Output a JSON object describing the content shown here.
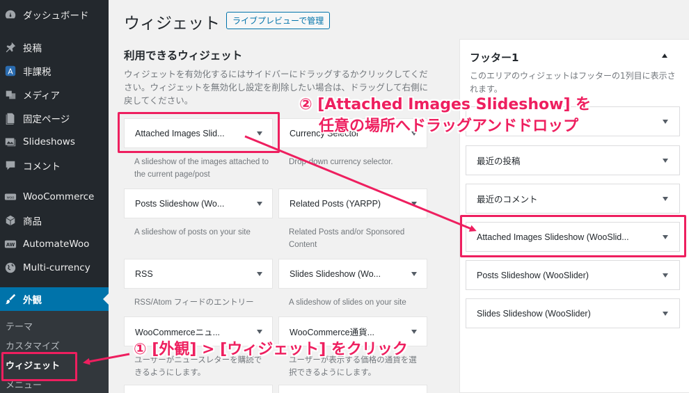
{
  "sidebar": {
    "items": [
      {
        "label": "ダッシュボード",
        "icon": "dashboard-icon"
      },
      {
        "label": "投稿",
        "icon": "pin-icon"
      },
      {
        "label": "非課税",
        "icon": "tax-icon"
      },
      {
        "label": "メディア",
        "icon": "media-icon"
      },
      {
        "label": "固定ページ",
        "icon": "page-icon"
      },
      {
        "label": "Slideshows",
        "icon": "slideshow-icon"
      },
      {
        "label": "コメント",
        "icon": "comment-icon"
      },
      {
        "label": "WooCommerce",
        "icon": "woo-icon"
      },
      {
        "label": "商品",
        "icon": "product-icon"
      },
      {
        "label": "AutomateWoo",
        "icon": "aw-icon"
      },
      {
        "label": "Multi-currency",
        "icon": "globe-icon"
      },
      {
        "label": "外観",
        "icon": "brush-icon"
      }
    ],
    "submenu": [
      "テーマ",
      "カスタマイズ",
      "ウィジェット",
      "メニュー"
    ]
  },
  "header": {
    "title": "ウィジェット",
    "live_preview_label": "ライブプレビューで管理"
  },
  "available": {
    "heading": "利用できるウィジェット",
    "description": "ウィジェットを有効化するにはサイドバーにドラッグするかクリックしてください。ウィジェットを無効化し設定を削除したい場合は、ドラッグして右側に戻してください。",
    "widgets": [
      {
        "title": "Attached Images Slid...",
        "desc": "A slideshow of the images attached to the current page/post"
      },
      {
        "title": "Currency Selector",
        "desc": "Drop-down currency selector."
      },
      {
        "title": "Posts Slideshow (Wo...",
        "desc": "A slideshow of posts on your site"
      },
      {
        "title": "Related Posts (YARPP)",
        "desc": "Related Posts and/or Sponsored Content"
      },
      {
        "title": "RSS",
        "desc": "RSS/Atom フィードのエントリー"
      },
      {
        "title": "Slides Slideshow (Wo...",
        "desc": "A slideshow of slides on your site"
      },
      {
        "title": "WooCommerceニュ...",
        "desc": "ユーザーがニュースレターを購読できるようにします。"
      },
      {
        "title": "WooCommerce通貨...",
        "desc": "ユーザーが表示する価格の通貨を選択できるようにします。"
      }
    ]
  },
  "footer_sidebar": {
    "title": "フッター1",
    "description": "このエリアのウィジェットはフッターの1列目に表示されます。",
    "widgets": [
      "",
      "最近の投稿",
      "最近のコメント",
      "Attached Images Slideshow (WooSlid...",
      "Posts Slideshow (WooSlider)",
      "Slides Slideshow (WooSlider)"
    ]
  },
  "annotations": {
    "step1": "① [外観] > [ウィジェット] をクリック",
    "step2_line1": "② [Attached Images Slideshow] を",
    "step2_line2": "任意の場所へドラッグアンドドロップ",
    "accent_color": "#ee1f5f"
  }
}
